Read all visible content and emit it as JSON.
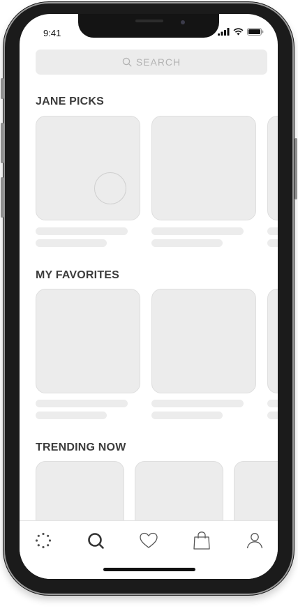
{
  "status_bar": {
    "time": "9:41"
  },
  "search": {
    "placeholder": "SEARCH"
  },
  "sections": [
    {
      "title": "JANE PICKS"
    },
    {
      "title": "MY FAVORITES"
    },
    {
      "title": "TRENDING NOW"
    }
  ],
  "tab_bar": {
    "icons": [
      "dots-loader-icon",
      "search-icon",
      "heart-icon",
      "shopping-bag-icon",
      "profile-icon"
    ]
  },
  "colors": {
    "placeholder_gray": "#ececec",
    "section_title": "#3c3c3c",
    "frame": "#1b1b1b"
  }
}
